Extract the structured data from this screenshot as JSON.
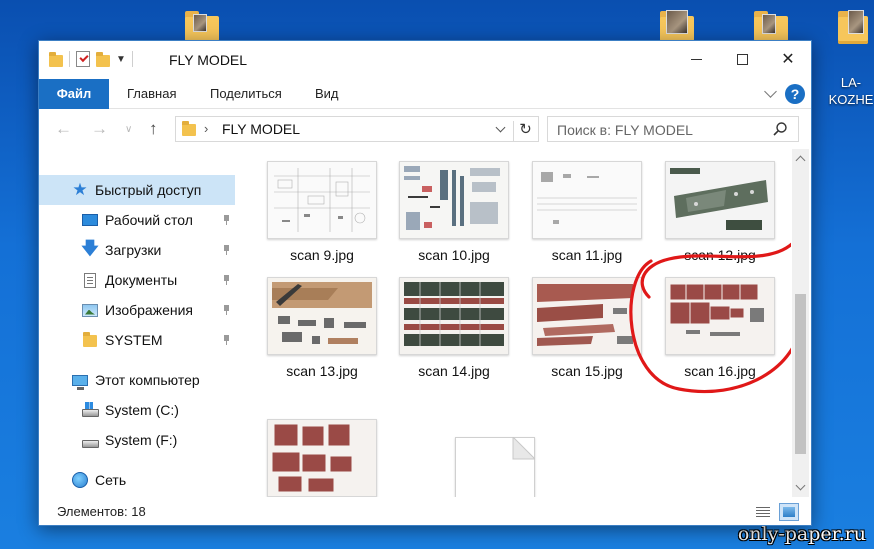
{
  "desktop": {
    "icons": [
      {
        "name": "folder-1",
        "label": ""
      },
      {
        "name": "folder-2",
        "label": ""
      },
      {
        "name": "folder-3",
        "label": ""
      },
      {
        "name": "folder-4",
        "label": "LA-\nKOZHE"
      }
    ],
    "watermark": "only-paper.ru"
  },
  "window": {
    "title": "FLY MODEL",
    "ribbon_tabs": [
      "Файл",
      "Главная",
      "Поделиться",
      "Вид"
    ],
    "help": "?",
    "address": "FLY MODEL",
    "search_placeholder": "Поиск в: FLY MODEL",
    "sidebar": [
      {
        "label": "Быстрый доступ",
        "icon": "star-icon",
        "pinned": false,
        "active": true
      },
      {
        "label": "Рабочий стол",
        "icon": "desktop-icon",
        "pinned": true
      },
      {
        "label": "Загрузки",
        "icon": "download-icon",
        "pinned": true
      },
      {
        "label": "Документы",
        "icon": "document-icon",
        "pinned": true
      },
      {
        "label": "Изображения",
        "icon": "pictures-icon",
        "pinned": true
      },
      {
        "label": "SYSTEM",
        "icon": "folder-icon",
        "pinned": true
      },
      {
        "label": "Этот компьютер",
        "icon": "computer-icon",
        "pinned": false
      },
      {
        "label": "System (C:)",
        "icon": "system-drive-icon",
        "pinned": false
      },
      {
        "label": "System (F:)",
        "icon": "drive-icon",
        "pinned": false
      },
      {
        "label": "Сеть",
        "icon": "network-icon",
        "pinned": false
      }
    ],
    "files": [
      {
        "name": "scan 9.jpg",
        "thumb": "line-drawing"
      },
      {
        "name": "scan 10.jpg",
        "thumb": "mixed-parts"
      },
      {
        "name": "scan 11.jpg",
        "thumb": "sparse-lines"
      },
      {
        "name": "scan 12.jpg",
        "thumb": "green-camo"
      },
      {
        "name": "scan 13.jpg",
        "thumb": "tan-wing"
      },
      {
        "name": "scan 14.jpg",
        "thumb": "green-strips"
      },
      {
        "name": "scan 15.jpg",
        "thumb": "red-strips"
      },
      {
        "name": "scan 16.jpg",
        "thumb": "red-panels"
      },
      {
        "name": "",
        "thumb": "red-panels"
      },
      {
        "name": "",
        "thumb": "blank-page"
      }
    ],
    "status": "Элементов: 18"
  },
  "colors": {
    "accent": "#1a6fc4",
    "selection": "#cce4f7",
    "annotation": "#e01818"
  }
}
